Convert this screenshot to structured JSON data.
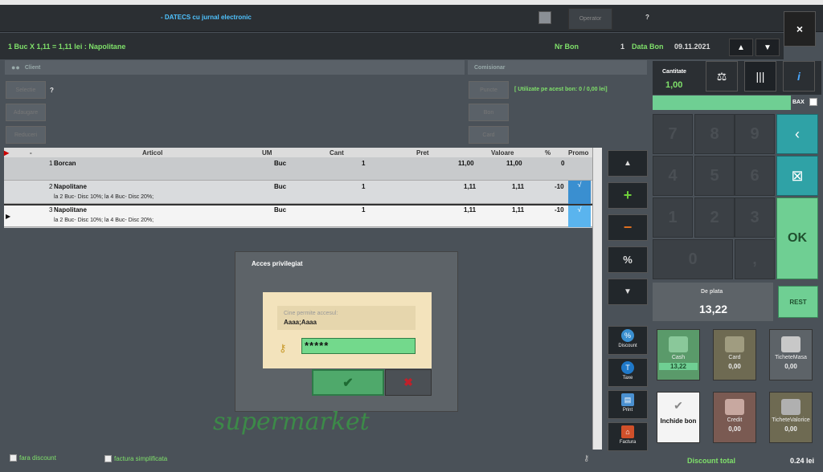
{
  "titlebar": {
    "title": "- DATECS cu jurnal electronic",
    "operator_label": "Operator",
    "help_label": "?",
    "close_label": "×"
  },
  "infobar": {
    "summary": "1 Buc X 1,11  = 1,11 lei : Napolitane",
    "nr_bon_label": "Nr Bon",
    "nr_bon_value": "1",
    "data_bon_label": "Data Bon",
    "data_bon_value": "09.11.2021",
    "up_arrow": "▲",
    "down_arrow": "▼"
  },
  "client": {
    "header": "Client",
    "question": "?",
    "buttons": [
      "Selectie",
      "Adaugare",
      "Reduceri"
    ]
  },
  "comisionar": {
    "header": "Comisionar",
    "info": "[ Utilizate pe acest bon: 0 / 0,00 lei]",
    "buttons": [
      "Puncte",
      "Bon",
      "Card"
    ]
  },
  "grid": {
    "headers": {
      "idx": "-",
      "articol": "Articol",
      "um": "UM",
      "cant": "Cant",
      "pret": "Pret",
      "valoare": "Valoare",
      "pct": "%",
      "promo": "Promo"
    },
    "rows": [
      {
        "idx": "1",
        "articol": "Borcan",
        "sub": "",
        "um": "Buc",
        "cant": "1",
        "pret": "11,00",
        "valoare": "11,00",
        "pct": "0",
        "promo": ""
      },
      {
        "idx": "2",
        "articol": "Napolitane",
        "sub": "la 2 Buc- Disc 10%; la 4 Buc- Disc 20%;",
        "um": "Buc",
        "cant": "1",
        "pret": "1,11",
        "valoare": "1,11",
        "pct": "-10",
        "promo": "√"
      },
      {
        "idx": "3",
        "articol": "Napolitane",
        "sub": "la 2 Buc- Disc 10%; la 4 Buc- Disc 20%;",
        "um": "Buc",
        "cant": "1",
        "pret": "1,11",
        "valoare": "1,11",
        "pct": "-10",
        "promo": "√"
      }
    ]
  },
  "side": {
    "up": "▲",
    "plus": "+",
    "minus": "−",
    "percent": "%",
    "down": "▼",
    "discount": "Discount",
    "taxe": "Taxe",
    "print": "Print",
    "factura": "Factura"
  },
  "dialog": {
    "title": "Acces privilegiat",
    "info_label": "Cine permite accesul:",
    "info_value": "Aaaa;Aaaa",
    "password": "*****",
    "ok": "✔",
    "cancel": "✖"
  },
  "watermark": "supermarket",
  "footer": {
    "fara_discount": "fara discount",
    "factura_simplificata": "factura simplificata",
    "discount_total_label": "Discount total",
    "discount_total_value": "0.24 lei"
  },
  "right": {
    "cantitate_label": "Cantitate",
    "cantitate_value": "1,00",
    "bax_label": "BAX",
    "keys": [
      "7",
      "8",
      "9",
      "4",
      "5",
      "6",
      "1",
      "2",
      "3",
      "0",
      ","
    ],
    "ok_label": "OK",
    "de_plata_label": "De plata",
    "de_plata_value": "13,22",
    "rest_label": "REST",
    "payments": [
      {
        "label": "Cash",
        "value": "13,22"
      },
      {
        "label": "Card",
        "value": "0,00"
      },
      {
        "label": "TicheteMasa",
        "value": "0,00"
      },
      {
        "label": "Inchide bon",
        "value": ""
      },
      {
        "label": "Credit",
        "value": "0,00"
      },
      {
        "label": "TicheteValorice",
        "value": "0,00"
      }
    ]
  }
}
